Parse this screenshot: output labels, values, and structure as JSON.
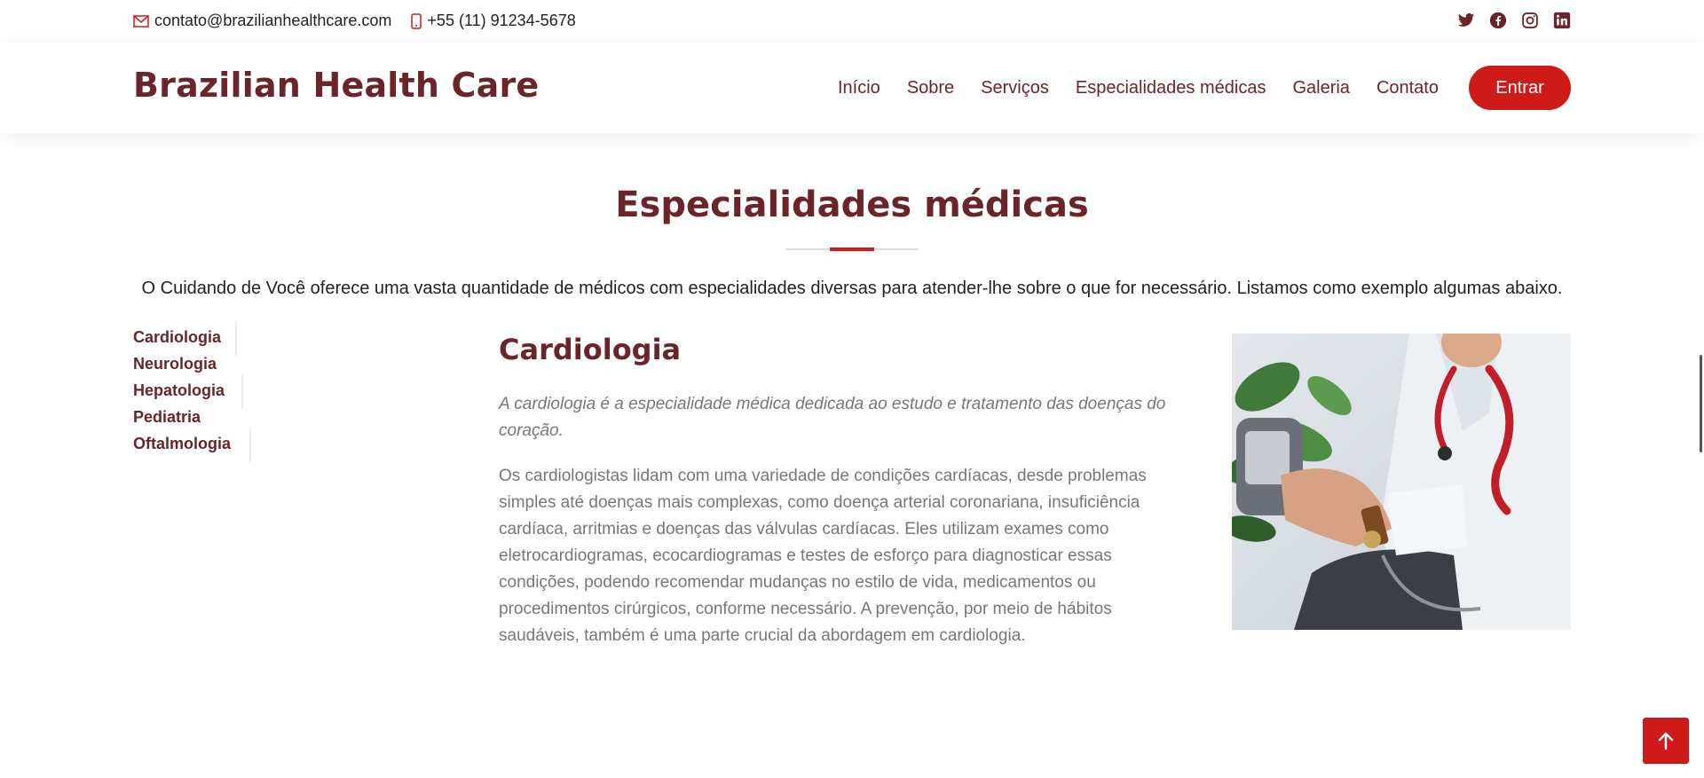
{
  "topbar": {
    "email": "contato@brazilianhealthcare.com",
    "phone": "+55 (11) 91234-5678",
    "social": [
      "twitter-icon",
      "facebook-icon",
      "instagram-icon",
      "linkedin-icon"
    ]
  },
  "header": {
    "logo": "Brazilian Health Care",
    "nav": [
      "Início",
      "Sobre",
      "Serviços",
      "Especialidades médicas",
      "Galeria",
      "Contato"
    ],
    "cta": "Entrar"
  },
  "section": {
    "title": "Especialidades médicas",
    "intro": "O Cuidando de Você oferece uma vasta quantidade de médicos com especialidades diversas para atender-lhe sobre o que for necessário. Listamos como exemplo algumas abaixo.",
    "tabs": [
      "Cardiologia",
      "Neurologia",
      "Hepatologia",
      "Pediatria",
      "Oftalmologia"
    ],
    "active_tab": "Cardiologia",
    "content": {
      "title": "Cardiologia",
      "lead": "A cardiologia é a especialidade médica dedicada ao estudo e tratamento das doenças do coração.",
      "body": "Os cardiologistas lidam com uma variedade de condições cardíacas, desde problemas simples até doenças mais complexas, como doença arterial coronariana, insuficiência cardíaca, arritmias e doenças das válvulas cardíacas. Eles utilizam exames como eletrocardiogramas, ecocardiogramas e testes de esforço para diagnosticar essas condições, podendo recomendar mudanças no estilo de vida, medicamentos ou procedimentos cirúrgicos, conforme necessário. A prevenção, por meio de hábitos saudáveis, também é uma parte crucial da abordagem em cardiologia."
    }
  },
  "colors": {
    "brand": "#6b2528",
    "accent": "#cf1a1a",
    "text": "#222222",
    "muted": "#777777"
  },
  "back_to_top_icon": "arrow-up-icon"
}
